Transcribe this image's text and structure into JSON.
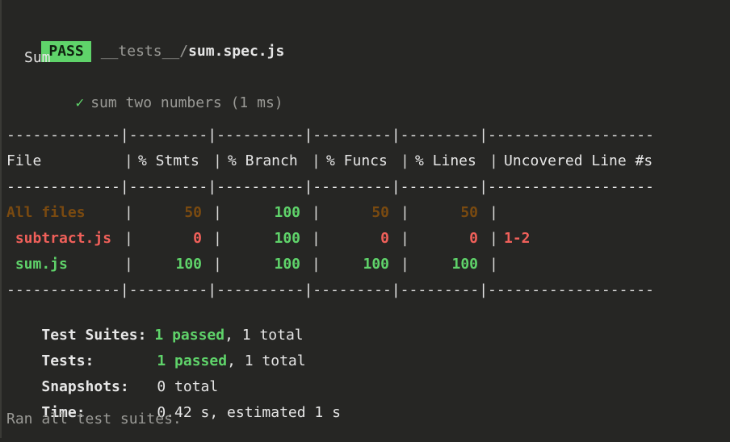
{
  "header": {
    "badge": "PASS",
    "path_prefix": "__tests__/",
    "path_file": "sum.spec.js"
  },
  "suite": {
    "name": "Sum",
    "check": "✓",
    "test": "sum two numbers (1 ms)"
  },
  "table": {
    "divider": "-------------|---------|----------|---------|---------|-------------------",
    "headers": [
      "File",
      "% Stmts",
      "% Branch",
      "% Funcs",
      "% Lines",
      "Uncovered Line #s"
    ],
    "rows": [
      {
        "file": "All files",
        "stmts": "50",
        "branch": "100",
        "funcs": "50",
        "lines": "50",
        "uncovered": ""
      },
      {
        "file": " subtract.js",
        "stmts": "0",
        "branch": "100",
        "funcs": "0",
        "lines": "0",
        "uncovered": "1-2"
      },
      {
        "file": " sum.js",
        "stmts": "100",
        "branch": "100",
        "funcs": "100",
        "lines": "100",
        "uncovered": ""
      }
    ]
  },
  "summary": {
    "suites_label": "Test Suites:",
    "suites_passed": "1 passed",
    "suites_total": ", 1 total",
    "tests_label": "Tests:",
    "tests_passed": "1 passed",
    "tests_total": ", 1 total",
    "snapshots_label": "Snapshots:",
    "snapshots_value": "0 total",
    "time_label": "Time:",
    "time_value": "0.42 s, estimated 1 s",
    "footer": "Ran all test suites."
  },
  "colors": {
    "background": "#262624",
    "pass_green": "#5fd36a",
    "fail_red": "#f0605a",
    "warn_brown": "#7a4a10"
  }
}
